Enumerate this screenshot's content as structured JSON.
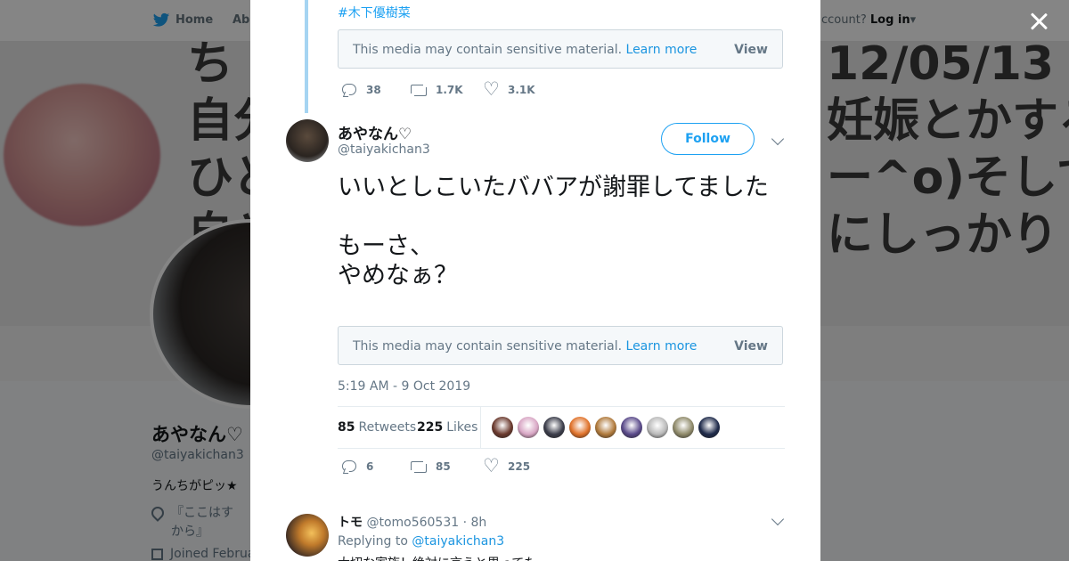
{
  "background": {
    "nav": {
      "home": "Home",
      "about": "Abo",
      "account_prompt": "ccount?",
      "login": "Log in"
    },
    "header_text": [
      "ち",
      "自分",
      "ひと",
      "自と"
    ],
    "header_text_right": [
      "12/05/13",
      "妊娠とかする",
      "ー^o)そして",
      "にしっかり"
    ],
    "profile": {
      "name": "あやなん♡",
      "handle": "@taiyakichan3",
      "bio": "うんちがピッ★",
      "location_line1": "『ここはす",
      "location_line2": "から』",
      "joined": "Joined Februa"
    }
  },
  "modal": {
    "prev_tweet": {
      "hashtag": "#木下優樹菜",
      "media_notice": "This media may contain sensitive material.",
      "learn_more": "Learn more",
      "view": "View",
      "replies": "38",
      "retweets": "1.7K",
      "likes": "3.1K"
    },
    "tweet": {
      "name": "あやなん♡",
      "handle": "@taiyakichan3",
      "follow": "Follow",
      "text": "いいとしこいたババアが謝罪してました\n\nもーさ、\nやめなぁ？",
      "media_notice": "This media may contain sensitive material.",
      "learn_more": "Learn more",
      "view": "View",
      "timestamp": "5:19 AM - 9 Oct 2019",
      "retweet_count": "85",
      "retweet_label": "Retweets",
      "like_count": "225",
      "like_label": "Likes",
      "replies": "6",
      "retweets": "85",
      "likes": "225",
      "liker_colors": [
        "#6b3a2e",
        "#d8a6c4",
        "#3b3d4a",
        "#e0722a",
        "#b07a3c",
        "#5a4a8a",
        "#b9b9b9",
        "#8f8a6a",
        "#1e2a4a"
      ]
    },
    "reply": {
      "name": "トモ",
      "handle": "@tomo560531",
      "time": "· 8h",
      "replying_to_label": "Replying to",
      "replying_to": "@taiyakichan3",
      "text": "大切な家族！絶対に言うと思ってた"
    }
  }
}
